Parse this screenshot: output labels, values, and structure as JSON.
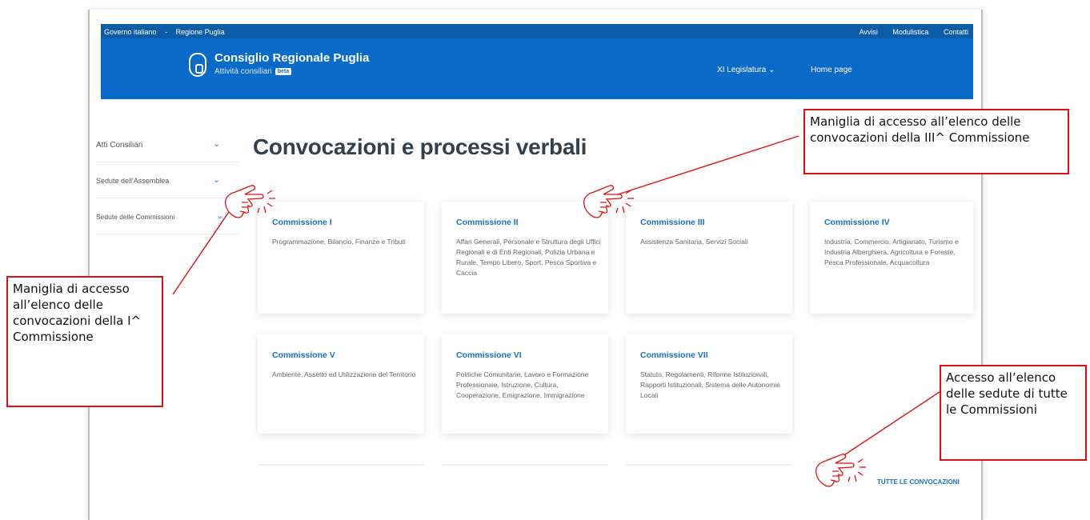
{
  "topbar": {
    "links_left": [
      "Governo italiano",
      "-",
      "Regione Puglia"
    ],
    "links_right": [
      "Avvisi",
      "Modulistica",
      "Contatti"
    ]
  },
  "header": {
    "title": "Consiglio Regionale Puglia",
    "subtitle": "Attività consiliari",
    "badge": "beta",
    "legislatura": "XI Legislatura",
    "homepage": "Home page",
    "logo_icon": "shield-icon",
    "colors": {
      "topbar": "#0d5ca8",
      "header": "#0a6ac8",
      "accent": "#1a6fc9"
    }
  },
  "sidebar": {
    "items": [
      {
        "label": "Atti Consiliari",
        "icon": "chevron-down-icon"
      },
      {
        "label": "Sedute dell'Assemblea",
        "icon": "chevron-down-icon"
      },
      {
        "label": "Sedute delle Commissioni",
        "icon": "chevron-down-icon"
      }
    ]
  },
  "main": {
    "title": "Convocazioni e processi verbali",
    "cards": [
      {
        "title": "Commissione I",
        "desc": "Programmazione, Bilancio, Finanze e Tributi"
      },
      {
        "title": "Commissione II",
        "desc": "Affari Generali, Personale e Struttura degli Uffici Regionali e di Enti Regionali, Polizia Urbana e Rurale, Tempo Libero, Sport, Pesca Sportiva e Caccia"
      },
      {
        "title": "Commissione III",
        "desc": "Assistenza Sanitaria, Servizi Sociali"
      },
      {
        "title": "Commissione IV",
        "desc": "Industria, Commercio, Artigianato, Turismo e Industria Alberghiera, Agricoltura e Foreste, Pesca Professionale, Acquacoltura"
      },
      {
        "title": "Commissione V",
        "desc": "Ambiente, Assetto ed Utilizzazione del Territorio"
      },
      {
        "title": "Commissione VI",
        "desc": "Politiche Comunitarie, Lavoro e Formazione Professionale, Istruzione, Cultura, Cooperazione, Emigrazione, Immigrazione"
      },
      {
        "title": "Commissione VII",
        "desc": "Statuto, Regolamenti, Riforme Istituzionali, Rapporti Istituzionali, Sistema delle Autonomie Locali"
      }
    ],
    "all_link": "TUTTE LE CONVOCAZIONI"
  },
  "annotations": {
    "note_iii": "Maniglia di accesso all’elenco delle convocazioni della III^ Commissione",
    "note_i": "Maniglia di accesso all’elenco delle convocazioni della I^ Commissione",
    "note_all": "Accesso all’elenco delle sedute di tutte le Commissioni",
    "pointer_icon": "hand-pointer-icon",
    "color": "#e01010"
  }
}
